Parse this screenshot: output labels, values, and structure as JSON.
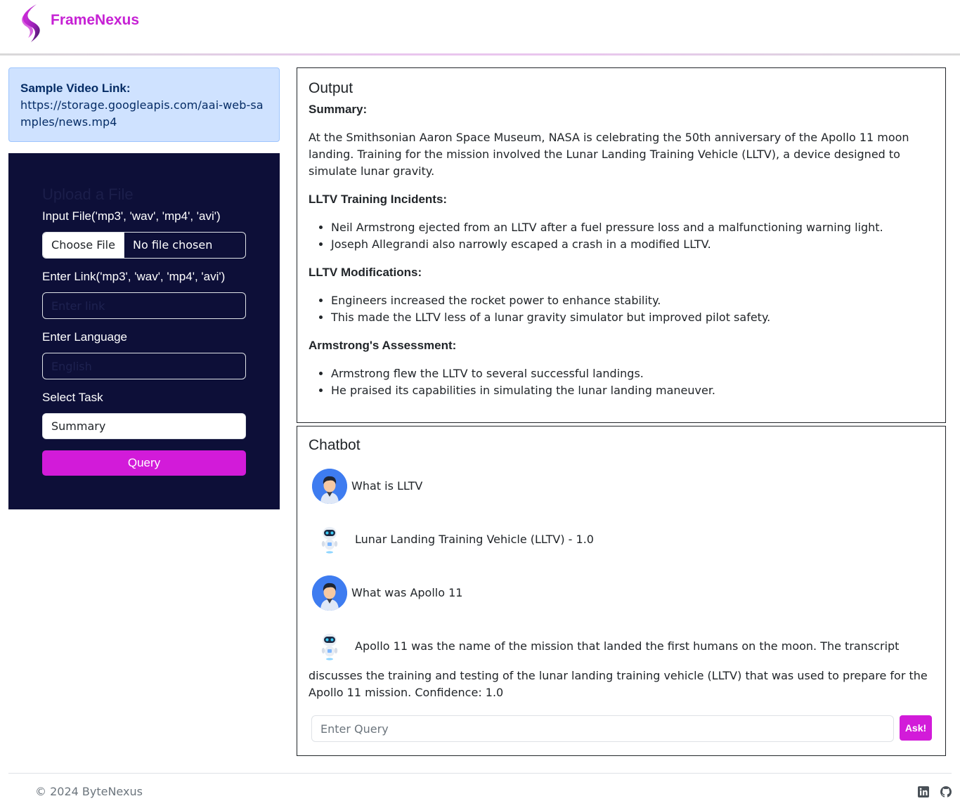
{
  "brand": {
    "name": "FrameNexus"
  },
  "sample": {
    "title": "Sample Video Link:",
    "url": "https://storage.googleapis.com/aai-web-samples/news.mp4"
  },
  "upload": {
    "title": "Upload a File",
    "file_label": "Input File('mp3', 'wav', 'mp4', 'avi')",
    "file_button": "Choose File",
    "file_status": "No file chosen",
    "link_label": "Enter Link('mp3', 'wav', 'mp4', 'avi')",
    "link_placeholder": "Enter link",
    "language_label": "Enter Language",
    "language_placeholder": "English",
    "task_label": "Select Task",
    "task_value": "Summary",
    "query_button": "Query"
  },
  "output": {
    "title": "Output",
    "summary_heading": "Summary",
    "summary_text": "At the Smithsonian Aaron Space Museum, NASA is celebrating the 50th anniversary of the Apollo 11 moon landing. Training for the mission involved the Lunar Landing Training Vehicle (LLTV), a device designed to simulate lunar gravity.",
    "incidents_heading": "LLTV Training Incidents",
    "incidents": [
      "Neil Armstrong ejected from an LLTV after a fuel pressure loss and a malfunctioning warning light.",
      "Joseph Allegrandi also narrowly escaped a crash in a modified LLTV."
    ],
    "modifications_heading": "LLTV Modifications",
    "modifications": [
      "Engineers increased the rocket power to enhance stability.",
      "This made the LLTV less of a lunar gravity simulator but improved pilot safety."
    ],
    "assessment_heading": "Armstrong's Assessment",
    "assessment": [
      "Armstrong flew the LLTV to several successful landings.",
      "He praised its capabilities in simulating the lunar landing maneuver."
    ]
  },
  "chat": {
    "title": "Chatbot",
    "messages": [
      {
        "role": "user",
        "text": "What is LLTV"
      },
      {
        "role": "bot",
        "text": "Lunar Landing Training Vehicle (LLTV) - 1.0"
      },
      {
        "role": "user",
        "text": "What was Apollo 11"
      },
      {
        "role": "bot",
        "text": "Apollo 11 was the name of the mission that landed the first humans on the moon. The transcript",
        "continuation": "discusses the training and testing of the lunar landing training vehicle (LLTV) that was used to prepare for the Apollo 11 mission. Confidence: 1.0"
      }
    ],
    "query_placeholder": "Enter Query",
    "ask_button": "Ask!"
  },
  "footer": {
    "copyright": "© 2024 ByteNexus",
    "icons": [
      "linkedin-icon",
      "github-icon"
    ]
  },
  "colors": {
    "accent": "#d21bd9",
    "brand": "#c621d4",
    "form_bg": "#0d0f38",
    "alert_bg": "#cfe2ff",
    "user_avatar": "#3e7cf0"
  }
}
